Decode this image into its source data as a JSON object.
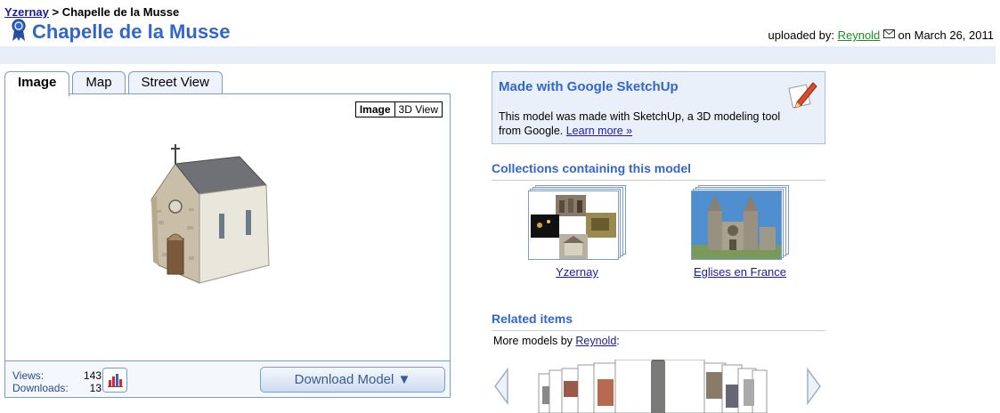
{
  "breadcrumb": {
    "root": "Yzernay",
    "sep": " > ",
    "current": "Chapelle de la Musse"
  },
  "title": "Chapelle de la Musse",
  "upload": {
    "prefix": "uploaded by: ",
    "user": "Reynold",
    "suffix": " on March 26, 2011"
  },
  "tabs": [
    {
      "label": "Image"
    },
    {
      "label": "Map"
    },
    {
      "label": "Street View"
    }
  ],
  "viewer": {
    "toggle": {
      "image": "Image",
      "view3d": "3D View"
    },
    "stats": {
      "views_label": "Views:",
      "views": "143",
      "downloads_label": "Downloads:",
      "downloads": "13"
    },
    "download_label": "Download Model ▼"
  },
  "sketchup": {
    "title": "Made with Google SketchUp",
    "text": "This model was made with SketchUp, a 3D modeling tool from Google. ",
    "link": "Learn more »"
  },
  "collections": {
    "title": "Collections containing this model",
    "items": [
      {
        "label": "Yzernay"
      },
      {
        "label": "Eglises en France"
      }
    ]
  },
  "related": {
    "title": "Related items",
    "more_prefix": "More models by ",
    "more_user": "Reynold",
    "more_suffix": ":"
  },
  "colors": {
    "accent": "#3366cc",
    "link": "#1a1aa6",
    "band": "#e8eef8"
  },
  "icons": [
    "ribbon-icon",
    "email-icon",
    "sketchup-pencil-icon",
    "stats-graph-icon",
    "carousel-left-icon",
    "carousel-right-icon"
  ]
}
